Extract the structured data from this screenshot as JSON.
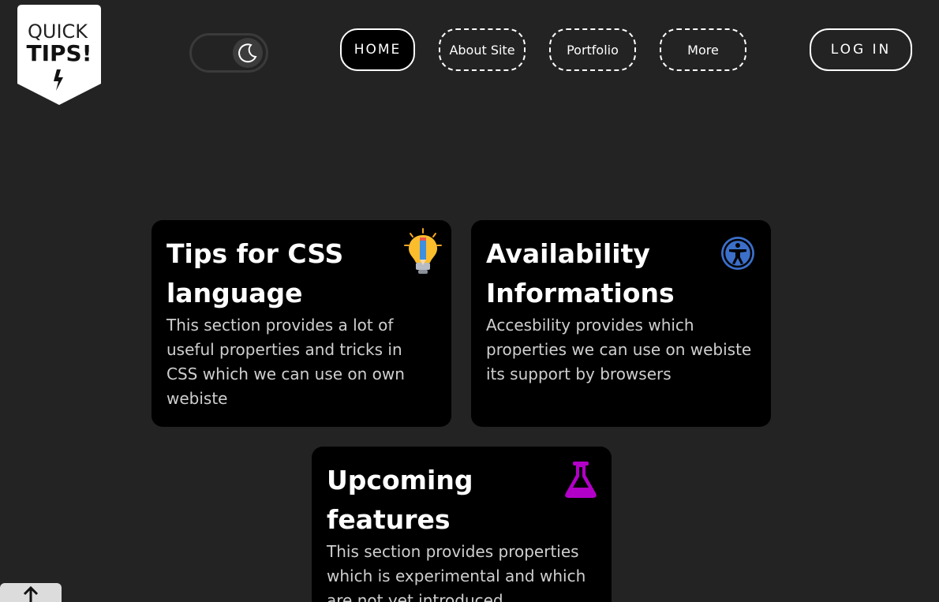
{
  "logo": {
    "line1": "QUICK",
    "line2": "TIPS!"
  },
  "theme_toggle": {
    "icon": "moon-icon"
  },
  "nav": {
    "home": "HOME",
    "about": "About Site",
    "portfolio": "Portfolio",
    "more": "More",
    "login": "LOG IN"
  },
  "cards": [
    {
      "title": "Tips for CSS language",
      "text": "This section provides a lot of useful properties and tricks in CSS which we can use on own webiste",
      "icon": "lightbulb-pencil-icon"
    },
    {
      "title": "Availability Informations",
      "text": "Accesbility provides which properties we can use on webiste its support by browsers",
      "icon": "accessibility-icon",
      "icon_color": "#3b6fc9"
    },
    {
      "title": "Upcoming features",
      "text": "This section provides properties which is experimental and which are not yet introduced",
      "icon": "flask-icon",
      "icon_color": "#b300c8"
    }
  ],
  "scroll_top": {
    "icon": "arrow-up-icon"
  },
  "colors": {
    "background": "#232323",
    "card": "#000000",
    "text_muted": "#cfcfcf"
  }
}
